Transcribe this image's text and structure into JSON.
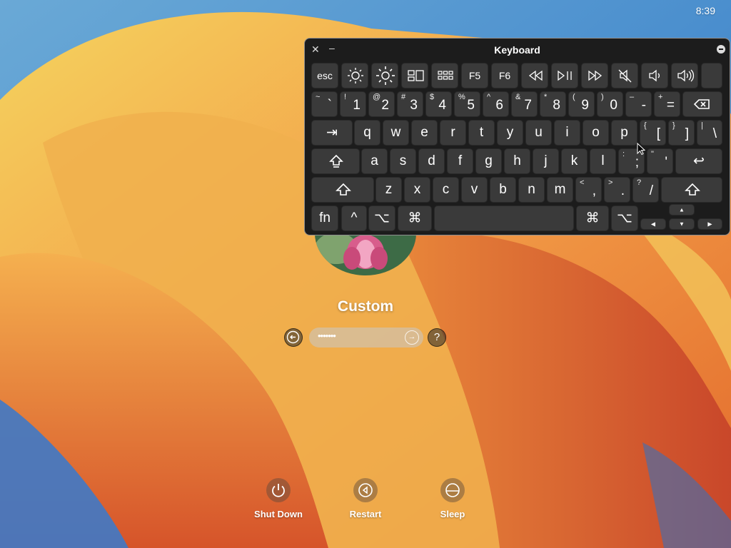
{
  "clock": "8:39",
  "login": {
    "username": "Custom",
    "password_mask": "•••••••",
    "back_icon": "arrow-left-circle-icon",
    "submit_icon": "arrow-right-circle-icon",
    "help_label": "?"
  },
  "power": [
    {
      "label": "Shut Down",
      "icon": "power-icon"
    },
    {
      "label": "Restart",
      "icon": "restart-icon"
    },
    {
      "label": "Sleep",
      "icon": "sleep-icon"
    }
  ],
  "keyboard_viewer": {
    "title": "Keyboard",
    "close": "✕",
    "minimize": "–",
    "row_fn": [
      "esc",
      "brightness-down-icon",
      "brightness-up-icon",
      "mission-control-icon",
      "launchpad-icon",
      "F5",
      "F6",
      "rewind-icon",
      "play-pause-icon",
      "fast-forward-icon",
      "mute-icon",
      "volume-down-icon",
      "volume-up-icon",
      ""
    ],
    "row_num": [
      {
        "top": "~",
        "bot": "`"
      },
      {
        "top": "!",
        "bot": "1"
      },
      {
        "top": "@",
        "bot": "2"
      },
      {
        "top": "#",
        "bot": "3"
      },
      {
        "top": "$",
        "bot": "4"
      },
      {
        "top": "%",
        "bot": "5"
      },
      {
        "top": "^",
        "bot": "6"
      },
      {
        "top": "&",
        "bot": "7"
      },
      {
        "top": "*",
        "bot": "8"
      },
      {
        "top": "(",
        "bot": "9"
      },
      {
        "top": ")",
        "bot": "0"
      },
      {
        "top": "–",
        "bot": "-"
      },
      {
        "top": "+",
        "bot": "="
      }
    ],
    "delete_icon": "delete-icon",
    "tab_label": "⇥",
    "row_q": [
      "q",
      "w",
      "e",
      "r",
      "t",
      "y",
      "u",
      "i",
      "o",
      "p"
    ],
    "row_q_punct": [
      {
        "top": "{",
        "bot": "["
      },
      {
        "top": "}",
        "bot": "]"
      },
      {
        "top": "|",
        "bot": "\\"
      }
    ],
    "caps_icon": "caps-lock-icon",
    "row_a": [
      "a",
      "s",
      "d",
      "f",
      "g",
      "h",
      "j",
      "k",
      "l"
    ],
    "row_a_punct": [
      {
        "top": ":",
        "bot": ";"
      },
      {
        "top": "\"",
        "bot": "'"
      }
    ],
    "return_label": "↩",
    "shift_icon": "shift-icon",
    "row_z": [
      "z",
      "x",
      "c",
      "v",
      "b",
      "n",
      "m"
    ],
    "row_z_punct": [
      {
        "top": "<",
        "bot": ","
      },
      {
        "top": ">",
        "bot": "."
      },
      {
        "top": "?",
        "bot": "/"
      }
    ],
    "bottom": {
      "fn": "fn",
      "control": "^",
      "option": "⌥",
      "command": "⌘",
      "arrow_up": "▲",
      "arrow_left": "◀",
      "arrow_down": "▼",
      "arrow_right": "▶"
    }
  }
}
